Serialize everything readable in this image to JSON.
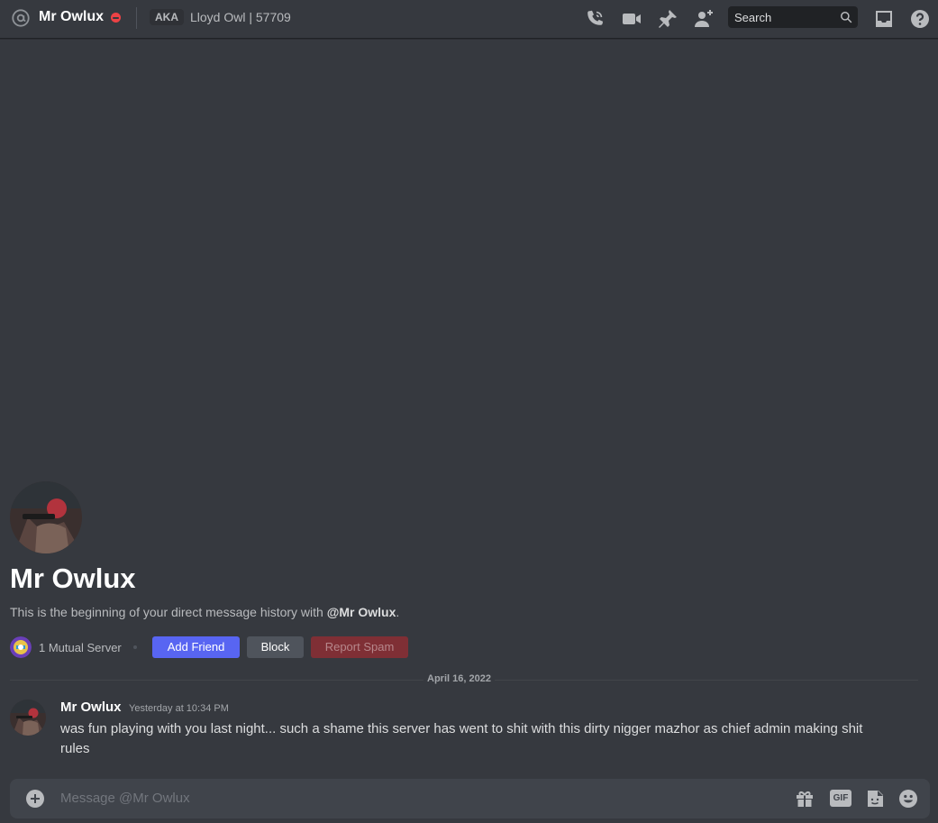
{
  "header": {
    "dm_name": "Mr Owlux",
    "aka_badge": "AKA",
    "aka_names": "Lloyd Owl | 57709",
    "search_placeholder": "Search"
  },
  "intro": {
    "name": "Mr Owlux",
    "description_prefix": "This is the beginning of your direct message history with ",
    "description_mention": "@Mr Owlux",
    "description_suffix": ".",
    "mutual_servers": "1 Mutual Server",
    "add_friend_label": "Add Friend",
    "block_label": "Block",
    "report_spam_label": "Report Spam"
  },
  "date_divider": "April 16, 2022",
  "messages": [
    {
      "author": "Mr Owlux",
      "timestamp": "Yesterday at 10:34 PM",
      "content": "was fun playing with you last night... such a shame this server has went to shit with this dirty nigger mazhor as chief admin making shit rules"
    }
  ],
  "composer": {
    "placeholder": "Message @Mr Owlux",
    "gif_label": "GIF"
  },
  "colors": {
    "background": "#36393f",
    "blurple": "#5865f2",
    "dnd_red": "#ed4245",
    "report_red": "#7f2f35"
  }
}
